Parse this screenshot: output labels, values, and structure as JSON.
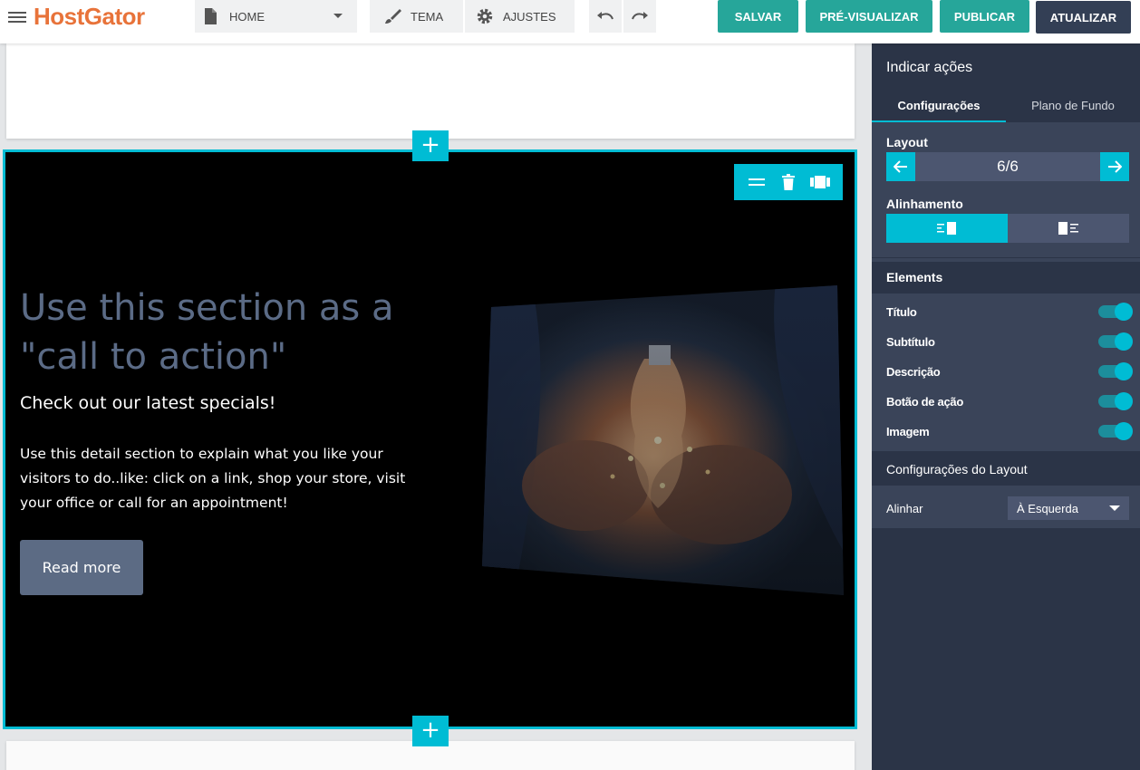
{
  "app": {
    "logo": "HostGator"
  },
  "toolbar": {
    "page_label": "HOME",
    "theme_label": "TEMA",
    "settings_label": "AJUSTES",
    "save_label": "SALVAR",
    "preview_label": "PRÉ-VISUALIZAR",
    "publish_label": "PUBLICAR",
    "update_label": "ATUALIZAR"
  },
  "section": {
    "title": "Use this section as a \"call to action\"",
    "subtitle": "Check out our latest specials!",
    "description": "Use this detail section to explain what you like your visitors to do..like: click on a link, shop your store, visit your office or call for an appointment!",
    "button_label": "Read more",
    "add_symbol": "+"
  },
  "panel": {
    "title": "Indicar ações",
    "tabs": [
      {
        "label": "Configurações",
        "active": true
      },
      {
        "label": "Plano de Fundo",
        "active": false
      }
    ],
    "layout_label": "Layout",
    "layout_value": "6/6",
    "alignment_label": "Alinhamento",
    "elements_title": "Elements",
    "elements": [
      {
        "label": "Título",
        "enabled": true
      },
      {
        "label": "Subtítulo",
        "enabled": true
      },
      {
        "label": "Descrição",
        "enabled": true
      },
      {
        "label": "Botão de ação",
        "enabled": true
      },
      {
        "label": "Imagem",
        "enabled": true
      }
    ],
    "layout_settings_title": "Configurações do Layout",
    "align_label": "Alinhar",
    "align_value": "À Esquerda"
  },
  "colors": {
    "accent": "#00bcd4",
    "green": "#26a69a",
    "dark": "#333f55",
    "logo": "#e8733a"
  }
}
